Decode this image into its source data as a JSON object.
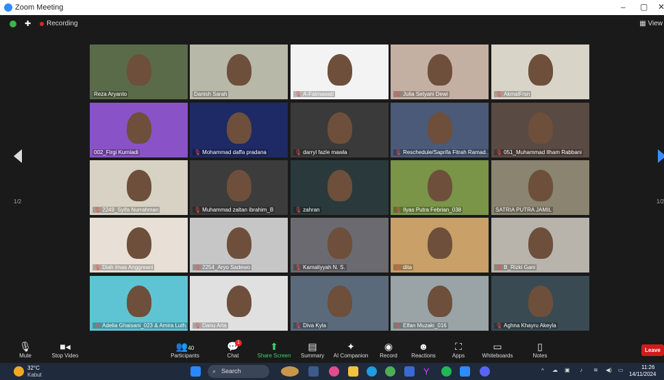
{
  "window": {
    "title": "Zoom Meeting",
    "minimize": "–",
    "maximize": "▢",
    "close": "✕"
  },
  "meeting": {
    "recording_label": "Recording",
    "view_label": "View"
  },
  "gallery": {
    "page_left": "1/2",
    "page_right": "1/2",
    "tiles": [
      {
        "name": "Reza Aryanto",
        "muted": false,
        "bg": "#5a6b4a",
        "active": false
      },
      {
        "name": "Danish Sarah",
        "muted": false,
        "bg": "#b8b8a8",
        "active": true
      },
      {
        "name": "A-Fatmawati",
        "muted": true,
        "bg": "#f3f3f3",
        "active": false
      },
      {
        "name": "Julia Setyani Dewi",
        "muted": true,
        "bg": "#c4b0a2",
        "active": false
      },
      {
        "name": "AkmalFrsn",
        "muted": true,
        "bg": "#d9d4c8",
        "active": false
      },
      {
        "name": "002_Firgi Kurniadi",
        "muted": false,
        "bg": "#8a52c7",
        "active": false
      },
      {
        "name": "Mohammad daffa pradana",
        "muted": true,
        "bg": "#1d2a66",
        "active": false
      },
      {
        "name": "darryl fazle mawla",
        "muted": true,
        "bg": "#3a3a3a",
        "active": false
      },
      {
        "name": "Reschedule/Saprifa Fitrah Ramad...",
        "muted": true,
        "bg": "#4a5a78",
        "active": false
      },
      {
        "name": "051_Muhammad Ilham Rabbani",
        "muted": true,
        "bg": "#5a4a44",
        "active": false
      },
      {
        "name": "2249_Syifa Nurrahman",
        "muted": true,
        "bg": "#d8d2c4",
        "active": false
      },
      {
        "name": "Muhammad zaltan ibrahim_B",
        "muted": true,
        "bg": "#3c3c3c",
        "active": false
      },
      {
        "name": "zahran",
        "muted": true,
        "bg": "#2a3a3c",
        "active": false
      },
      {
        "name": "Ilyas Putra Febrian_038",
        "muted": true,
        "bg": "#7a9448",
        "active": false
      },
      {
        "name": "SATRIA PUTRA JAMIL",
        "muted": false,
        "bg": "#8a8470",
        "active": false
      },
      {
        "name": "Diah Imas Anggreani",
        "muted": true,
        "bg": "#e8e0d6",
        "active": false
      },
      {
        "name": "2254_Aryo Sadewo",
        "muted": true,
        "bg": "#c6c6c6",
        "active": false
      },
      {
        "name": "Kamaliyyah N. S.",
        "muted": true,
        "bg": "#6a6a70",
        "active": false
      },
      {
        "name": "dita",
        "muted": true,
        "bg": "#c8a068",
        "active": false
      },
      {
        "name": "B_Rizki Gani",
        "muted": true,
        "bg": "#b8b4ac",
        "active": false
      },
      {
        "name": "Adelia Ghaisani_023 & Amira Luth...",
        "muted": true,
        "bg": "#5ec4d4",
        "active": false
      },
      {
        "name": "Danu Arta",
        "muted": true,
        "bg": "#e0e0e0",
        "active": false
      },
      {
        "name": "Diva Kyla",
        "muted": true,
        "bg": "#5a6a7a",
        "active": false
      },
      {
        "name": "Elfan Muzaki_016",
        "muted": true,
        "bg": "#9aa4a6",
        "active": false
      },
      {
        "name": "Aghna Khayru Akeyla",
        "muted": true,
        "bg": "#3a4a52",
        "active": false
      }
    ]
  },
  "toolbar": {
    "mute": "Mute",
    "stop_video": "Stop Video",
    "participants": "Participants",
    "participants_count": "40",
    "chat": "Chat",
    "chat_badge": "1",
    "share_screen": "Share Screen",
    "summary": "Summary",
    "ai_companion": "AI Companion",
    "record": "Record",
    "reactions": "Reactions",
    "apps": "Apps",
    "whiteboards": "Whiteboards",
    "notes": "Notes",
    "leave": "Leave"
  },
  "taskbar": {
    "weather_temp": "32°C",
    "weather_desc": "Kabut",
    "search_placeholder": "Search",
    "time": "11:26",
    "date": "14/11/2024"
  }
}
